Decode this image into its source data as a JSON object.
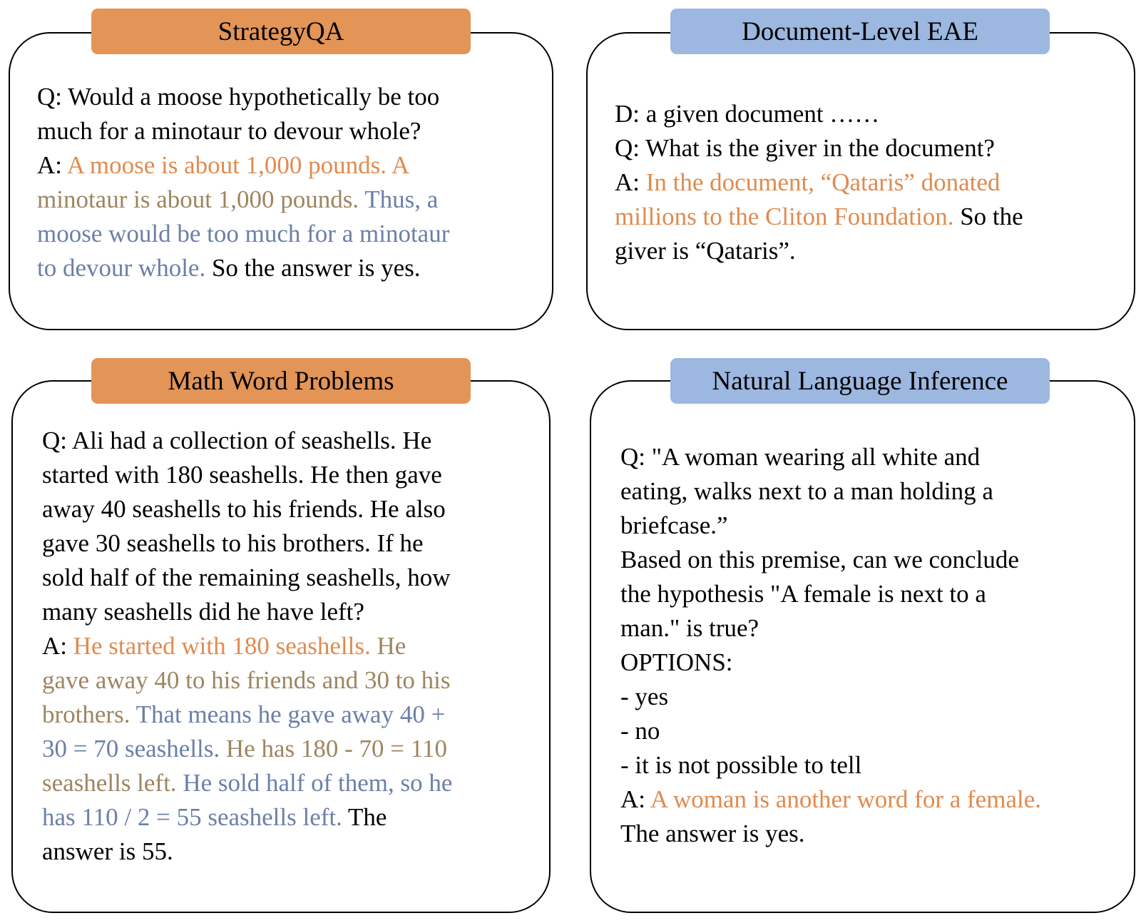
{
  "colors": {
    "label_orange": "#E39457",
    "label_blue": "#9CB7E0",
    "text_black": "#000000",
    "highlight_orange": "#E08B4E",
    "highlight_olive": "#9E8560",
    "highlight_blue": "#6B7FA8"
  },
  "panels": [
    {
      "title": "StrategyQA",
      "lines": [
        [
          {
            "t": "Q: Would a moose hypothetically be too",
            "c": "black"
          }
        ],
        [
          {
            "t": "much for a minotaur to devour whole?",
            "c": "black"
          }
        ],
        [
          {
            "t": "A: ",
            "c": "black"
          },
          {
            "t": "A moose is about 1,000 pounds. A",
            "c": "orange"
          }
        ],
        [
          {
            "t": "minotaur is about 1,000 pounds. ",
            "c": "olive"
          },
          {
            "t": "Thus, a",
            "c": "blue"
          }
        ],
        [
          {
            "t": "moose would be too much for a minotaur",
            "c": "blue"
          }
        ],
        [
          {
            "t": "to devour whole.",
            "c": "blue"
          },
          {
            "t": " So the answer is yes.",
            "c": "black"
          }
        ]
      ]
    },
    {
      "title": "Document-Level EAE",
      "lines": [
        [
          {
            "t": "D: a given document ……",
            "c": "black"
          }
        ],
        [
          {
            "t": "Q: What is the giver in the document?",
            "c": "black"
          }
        ],
        [
          {
            "t": "A: ",
            "c": "black"
          },
          {
            "t": "In the document, “Qataris” donated",
            "c": "orange"
          }
        ],
        [
          {
            "t": "millions to the Cliton Foundation.",
            "c": "orange"
          },
          {
            "t": " So the",
            "c": "black"
          }
        ],
        [
          {
            "t": "giver is “Qataris”.",
            "c": "black"
          }
        ]
      ]
    },
    {
      "title": "Math Word Problems",
      "lines": [
        [
          {
            "t": "Q: Ali had a collection of seashells. He",
            "c": "black"
          }
        ],
        [
          {
            "t": "started with 180 seashells. He then gave",
            "c": "black"
          }
        ],
        [
          {
            "t": "away 40 seashells to his friends. He also",
            "c": "black"
          }
        ],
        [
          {
            "t": "gave 30 seashells to his brothers. If he",
            "c": "black"
          }
        ],
        [
          {
            "t": "sold half of the remaining seashells, how",
            "c": "black"
          }
        ],
        [
          {
            "t": "many seashells did he have left?",
            "c": "black"
          }
        ],
        [
          {
            "t": "A: ",
            "c": "black"
          },
          {
            "t": "He started with 180 seashells. ",
            "c": "orange"
          },
          {
            "t": "He",
            "c": "olive"
          }
        ],
        [
          {
            "t": "gave away 40 to his friends and 30 to his",
            "c": "olive"
          }
        ],
        [
          {
            "t": "brothers. ",
            "c": "olive"
          },
          {
            "t": "That means he gave away 40 +",
            "c": "blue"
          }
        ],
        [
          {
            "t": "30 = 70 seashells. ",
            "c": "blue"
          },
          {
            "t": "He has 180 - 70 = 110",
            "c": "olive"
          }
        ],
        [
          {
            "t": "seashells left. ",
            "c": "olive"
          },
          {
            "t": "He sold half of them, so he",
            "c": "blue"
          }
        ],
        [
          {
            "t": "has 110 / 2 = 55 seashells left.",
            "c": "blue"
          },
          {
            "t": " The",
            "c": "black"
          }
        ],
        [
          {
            "t": "answer is 55.",
            "c": "black"
          }
        ]
      ]
    },
    {
      "title": "Natural Language Inference",
      "lines": [
        [
          {
            "t": "Q: \"A woman wearing all white and",
            "c": "black"
          }
        ],
        [
          {
            "t": "eating, walks next to a man holding a",
            "c": "black"
          }
        ],
        [
          {
            "t": "briefcase.”",
            "c": "black"
          }
        ],
        [
          {
            "t": "Based on this premise, can we conclude",
            "c": "black"
          }
        ],
        [
          {
            "t": "the hypothesis \"A female is next to a",
            "c": "black"
          }
        ],
        [
          {
            "t": "man.\" is true?",
            "c": "black"
          }
        ],
        [
          {
            "t": "OPTIONS:",
            "c": "black"
          }
        ],
        [
          {
            "t": "- yes",
            "c": "black"
          }
        ],
        [
          {
            "t": "- no",
            "c": "black"
          }
        ],
        [
          {
            "t": "- it is not possible to tell",
            "c": "black"
          }
        ],
        [
          {
            "t": "A: ",
            "c": "black"
          },
          {
            "t": "A woman is another word for a female.",
            "c": "orange"
          }
        ],
        [
          {
            "t": "The answer is yes.",
            "c": "black"
          }
        ]
      ]
    }
  ]
}
